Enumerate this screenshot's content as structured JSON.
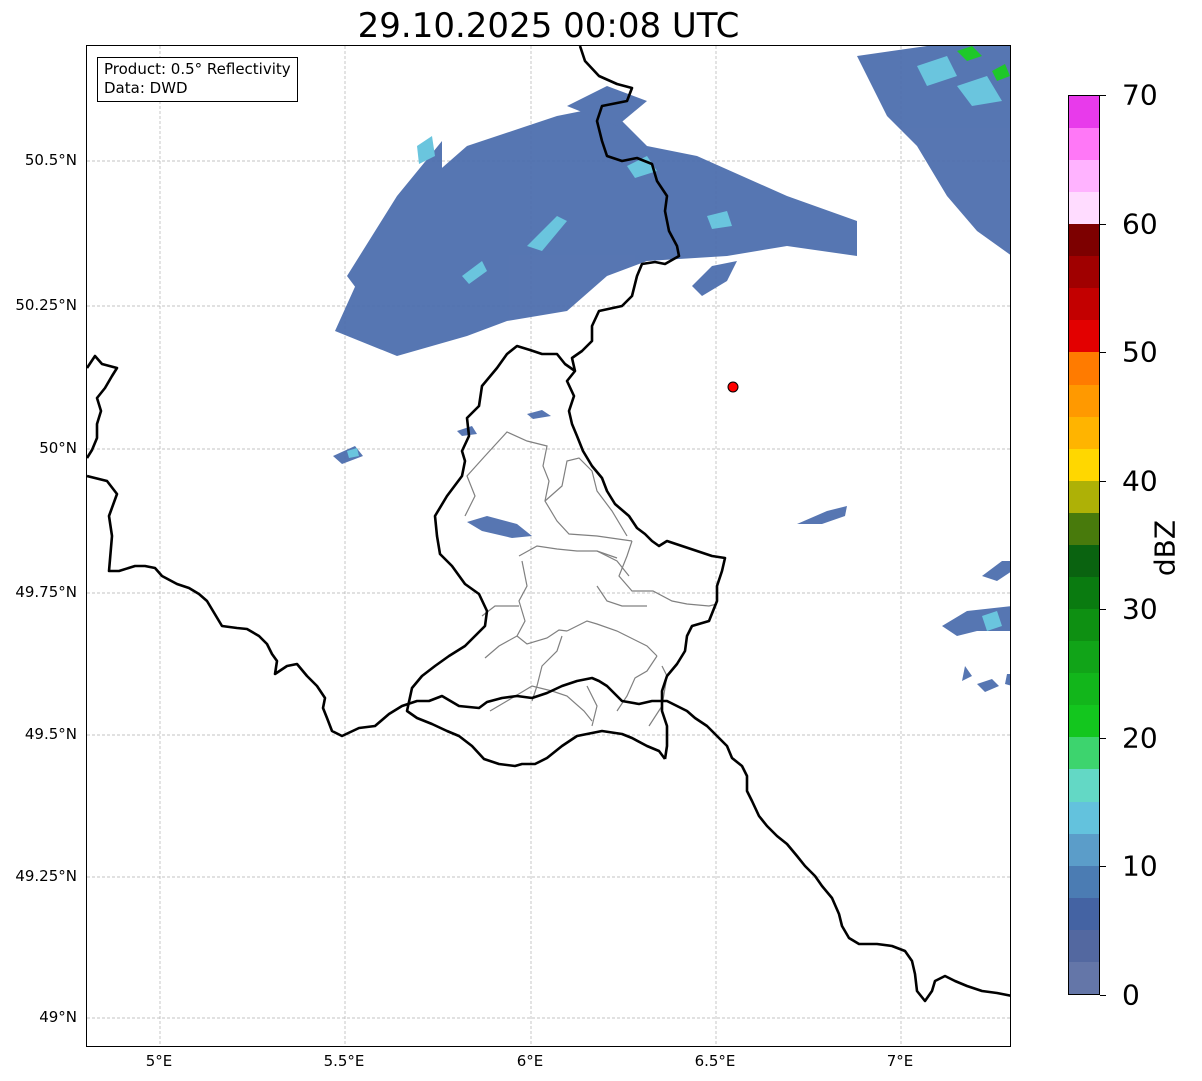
{
  "title": "29.10.2025 00:08 UTC",
  "info_box": {
    "product": "Product: 0.5° Reflectivity",
    "data": "Data: DWD"
  },
  "lat_labels": [
    "50.5°N",
    "50.25°N",
    "50°N",
    "49.75°N",
    "49.5°N",
    "49.25°N",
    "49°N"
  ],
  "lon_labels": [
    "5°E",
    "5.5°E",
    "6°E",
    "6.5°E",
    "7°E"
  ],
  "colorbar": {
    "unit": "dBZ",
    "tick_labels": [
      "0",
      "10",
      "20",
      "30",
      "40",
      "50",
      "60",
      "70"
    ],
    "colors": [
      "#6476a8",
      "#5368a0",
      "#4463a3",
      "#4b7cb3",
      "#5b9dc9",
      "#63c2dd",
      "#63d8c5",
      "#3dd46e",
      "#13c61e",
      "#12b61b",
      "#11a418",
      "#0e9012",
      "#0a7b10",
      "#0a6310",
      "#487a0c",
      "#aeb106",
      "#ffd700",
      "#ffb400",
      "#ff9900",
      "#ff7b00",
      "#e30000",
      "#c30000",
      "#a00000",
      "#7d0000",
      "#ffdcff",
      "#ffb3ff",
      "#ff78f7",
      "#e83aeb"
    ]
  },
  "radar_site": {
    "name": "radar-site",
    "color": "#ff0000"
  },
  "colors": {
    "border": "#000000",
    "district": "#808080",
    "gridline": "#b0b0b0"
  }
}
